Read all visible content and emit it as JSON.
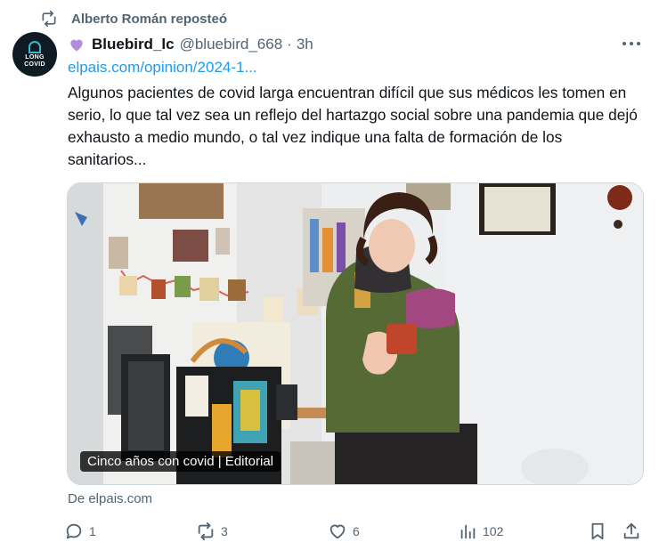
{
  "repost": {
    "text": "Alberto Román reposteó",
    "icon": "repost-icon"
  },
  "avatar": {
    "text_line1": "LONG",
    "text_line2": "COVID",
    "icon": "awareness-ribbon-icon"
  },
  "author": {
    "emoji": "purple-heart-icon",
    "display_name": "Bluebird_lc",
    "handle": "@bluebird_668",
    "separator": "·",
    "time": "3h"
  },
  "tweet": {
    "link": "elpais.com/opinion/2024-1...",
    "text": "Algunos pacientes de covid larga encuentran difícil que sus médicos les tomen en serio, lo que tal vez sea un reflejo del hartazgo social sobre una pandemia que dejó exhausto a medio mundo, o tal vez indique una falta de formación de los sanitarios..."
  },
  "card": {
    "caption": "Cinco años con covid | Editorial",
    "source": "De elpais.com"
  },
  "actions": {
    "reply_count": "1",
    "repost_count": "3",
    "like_count": "6",
    "views_count": "102"
  },
  "colors": {
    "accent": "#1d9bf0",
    "muted": "#536471",
    "heart": "#b48cde"
  }
}
